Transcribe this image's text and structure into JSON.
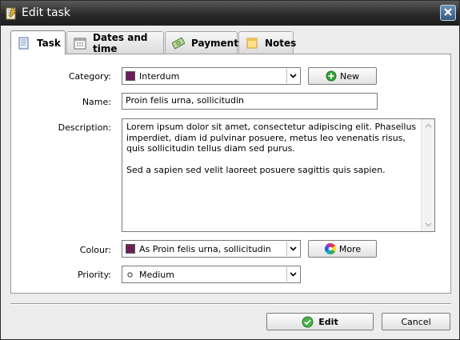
{
  "window": {
    "title": "Edit task",
    "title_icon": "notepad-icon",
    "close_icon": "close-icon"
  },
  "tabs": [
    {
      "label": "Task",
      "icon": "notepad-icon",
      "active": true
    },
    {
      "label": "Dates and time",
      "icon": "calendar-icon",
      "active": false
    },
    {
      "label": "Payment",
      "icon": "money-icon",
      "active": false
    },
    {
      "label": "Notes",
      "icon": "note-icon",
      "active": false
    }
  ],
  "form": {
    "category": {
      "label": "Category:",
      "value": "Interdum",
      "swatch_color": "#6b1f5a"
    },
    "new_button": {
      "label": "New",
      "icon": "add-icon"
    },
    "name": {
      "label": "Name:",
      "value": "Proin felis urna, sollicitudin"
    },
    "description": {
      "label": "Description:",
      "paragraph1": "Lorem ipsum dolor sit amet, consectetur adipiscing elit. Phasellus imperdiet, diam id pulvinar posuere, metus leo venenatis risus, quis sollicitudin tellus diam sed purus.",
      "paragraph2": "Sed a sapien sed velit laoreet posuere sagittis quis sapien."
    },
    "colour": {
      "label": "Colour:",
      "value": "As Proin felis urna, sollicitudin",
      "swatch_color": "#6b1f5a"
    },
    "more_button": {
      "label": "More",
      "icon": "color-wheel-icon"
    },
    "priority": {
      "label": "Priority:",
      "value": "Medium",
      "icon": "circle-icon"
    }
  },
  "footer": {
    "edit_button": {
      "label": "Edit",
      "icon": "checkmark-icon"
    },
    "cancel_button": {
      "label": "Cancel"
    }
  }
}
